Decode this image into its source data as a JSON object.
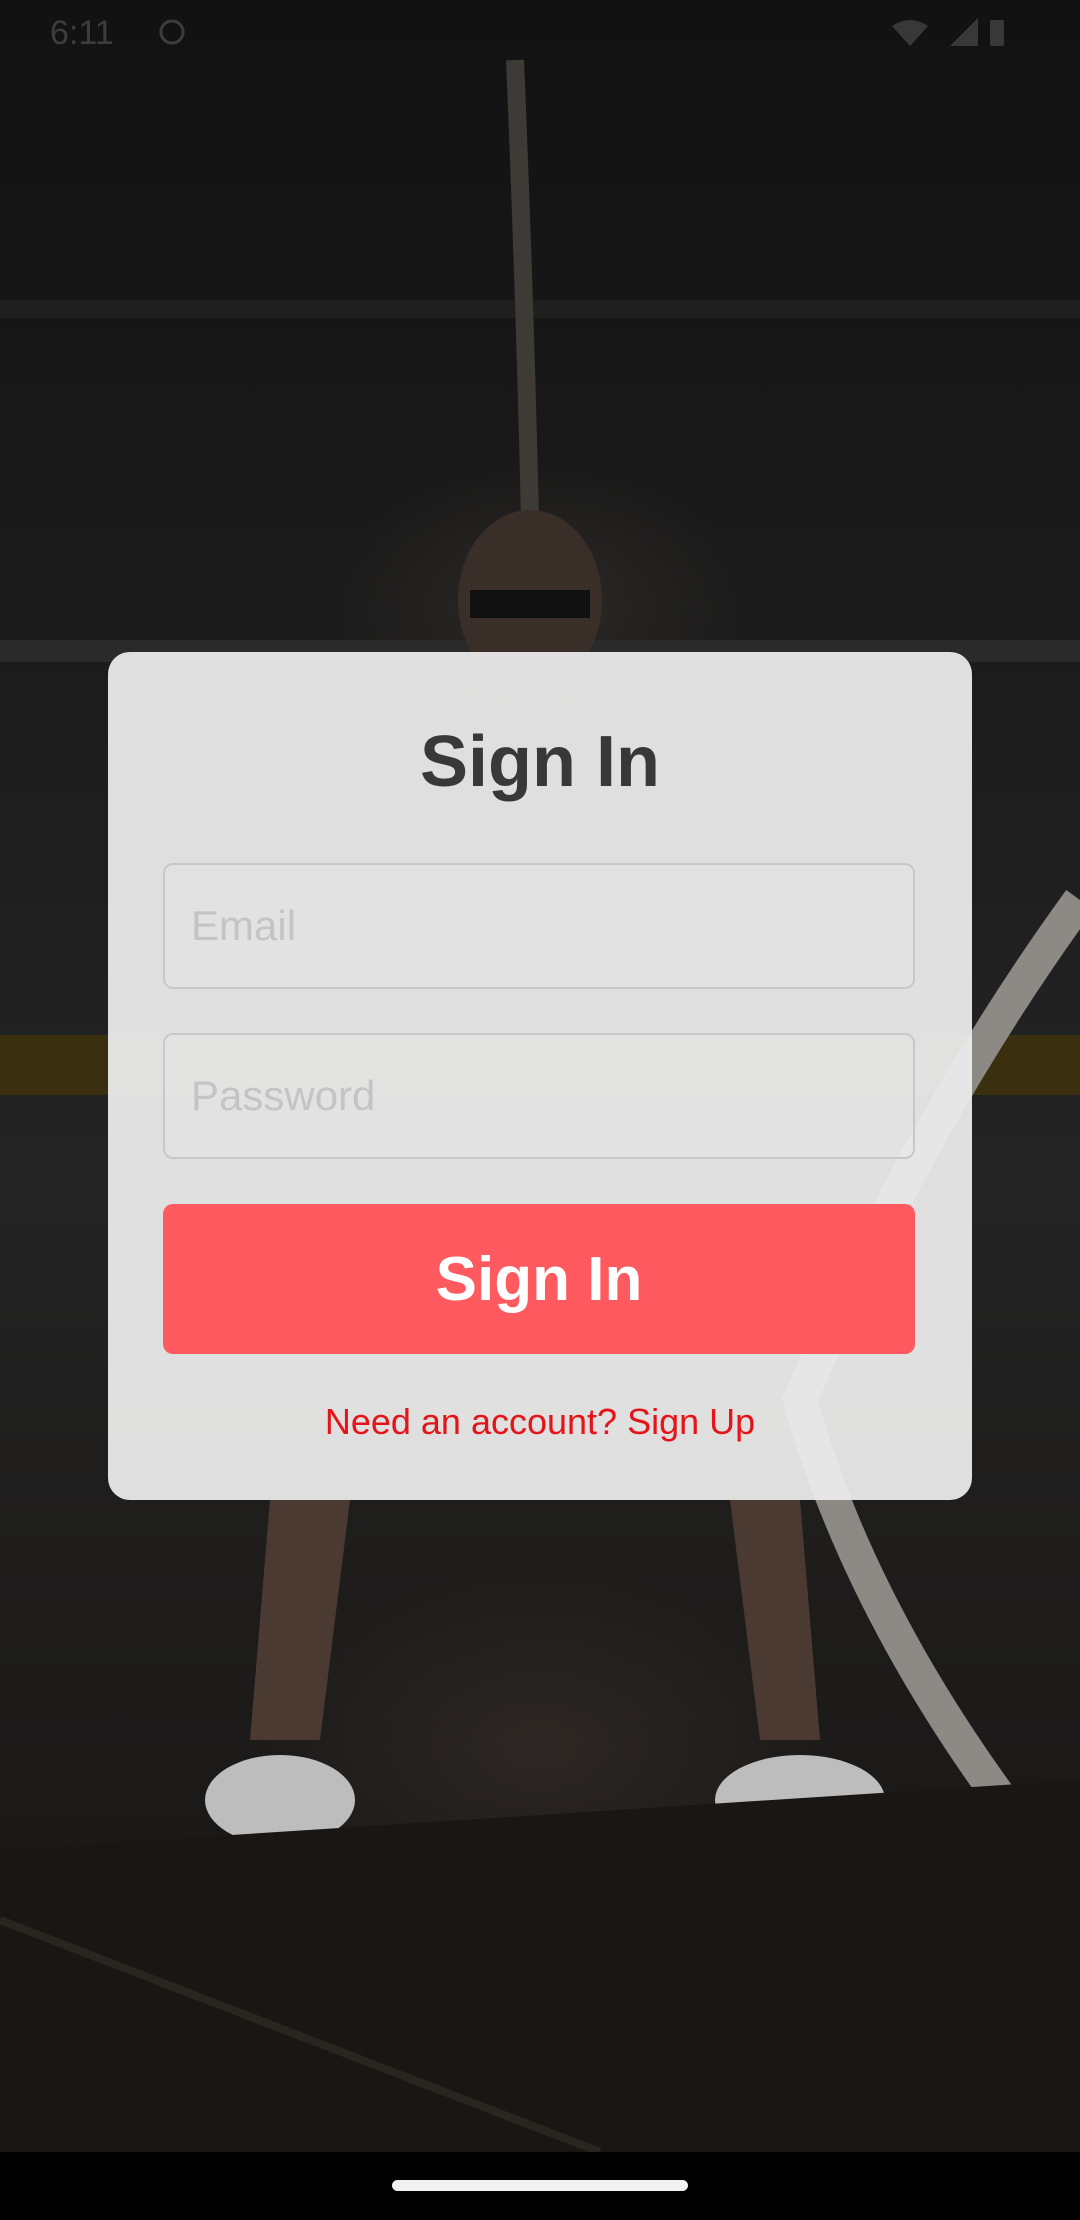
{
  "status_bar": {
    "time": "6:11",
    "left_icon": "shield-icon",
    "right_icons": [
      "wifi-icon",
      "signal-icon",
      "battery-icon"
    ]
  },
  "background": {
    "description_icon": "gym-photo-background"
  },
  "card": {
    "title": "Sign In",
    "email": {
      "placeholder": "Email",
      "value": ""
    },
    "password": {
      "placeholder": "Password",
      "value": ""
    },
    "signin_button_label": "Sign In",
    "signup_link": "Need an account? Sign Up"
  },
  "colors": {
    "accent": "#fe5a5f",
    "link": "#e5131a",
    "title": "#383838",
    "card_bg": "#ececec"
  }
}
